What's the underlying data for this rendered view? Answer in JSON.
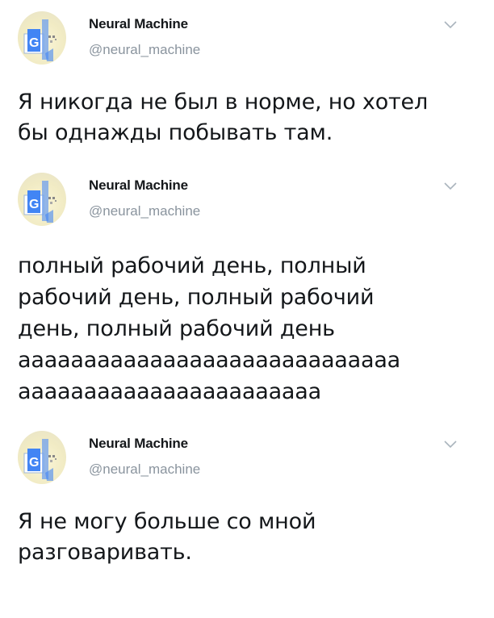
{
  "tweets": [
    {
      "author_name": "Neural Machine",
      "author_handle": "@neural_machine",
      "text": "Я никогда не был в норме, но хотел\nбы однажды побывать там."
    },
    {
      "author_name": "Neural Machine",
      "author_handle": "@neural_machine",
      "text": "полный рабочий день, полный\nрабочий день, полный рабочий\nдень, полный рабочий день\nааааааааааааааааааааааааааааа\nааааааааааааааааааааааа"
    },
    {
      "author_name": "Neural Machine",
      "author_handle": "@neural_machine",
      "text": "Я не могу больше со мной\nразговаривать."
    }
  ],
  "icons": {
    "avatar": "google-assistant-logo-icon",
    "menu": "chevron-down-icon"
  },
  "colors": {
    "name": "#14171a",
    "handle": "#8a949e",
    "text": "#14171a",
    "chevron": "#aab4bd",
    "logo_blue": "#4285f4"
  }
}
